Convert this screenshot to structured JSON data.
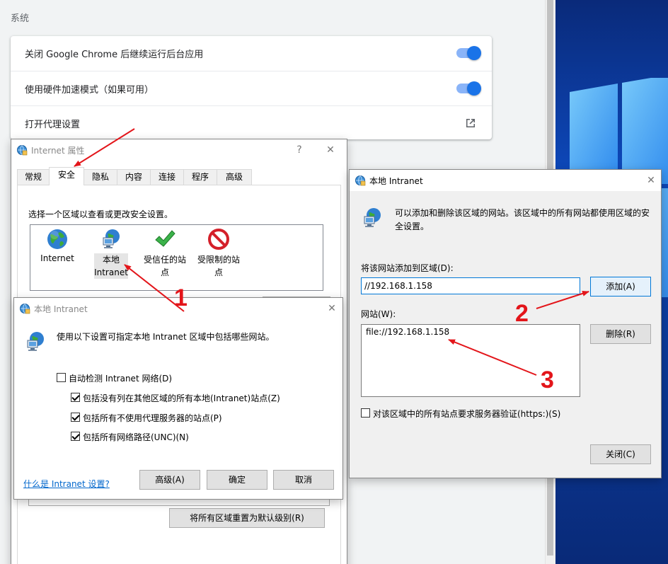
{
  "chrome_settings": {
    "section_title": "系统",
    "rows": [
      {
        "label": "关闭 Google Chrome 后继续运行后台应用",
        "type": "toggle",
        "checked": true
      },
      {
        "label": "使用硬件加速模式（如果可用）",
        "type": "toggle",
        "checked": true
      },
      {
        "label": "打开代理设置",
        "type": "external-link",
        "icon": "external-link-icon"
      }
    ]
  },
  "internet_properties": {
    "title": "Internet 属性",
    "help": "?",
    "close": "✕",
    "tabs": [
      "常规",
      "安全",
      "隐私",
      "内容",
      "连接",
      "程序",
      "高级"
    ],
    "active_tab": "安全",
    "prompt": "选择一个区域以查看或更改安全设置。",
    "zones": [
      {
        "label": "Internet",
        "icon": "globe-icon"
      },
      {
        "label": "本地 Intranet",
        "icon": "intranet-icon"
      },
      {
        "label": "受信任的站点",
        "icon": "checkmark-icon"
      },
      {
        "label": "受限制的站点",
        "icon": "forbidden-icon"
      }
    ],
    "reset_all_label": "将所有区域重置为默认级别(R)"
  },
  "intranet_small": {
    "title": "本地 Intranet",
    "close": "✕",
    "description": "使用以下设置可指定本地 Intranet 区域中包括哪些网站。",
    "options": [
      {
        "label": "自动检测 Intranet 网络(D)",
        "checked": false
      },
      {
        "label": "包括没有列在其他区域的所有本地(Intranet)站点(Z)",
        "checked": true
      },
      {
        "label": "包括所有不使用代理服务器的站点(P)",
        "checked": true
      },
      {
        "label": "包括所有网络路径(UNC)(N)",
        "checked": true
      }
    ],
    "help_link": "什么是 Intranet 设置?",
    "buttons": {
      "advanced": "高级(A)",
      "ok": "确定",
      "cancel": "取消"
    }
  },
  "intranet_large": {
    "title": "本地 Intranet",
    "close": "✕",
    "description": "可以添加和删除该区域的网站。该区域中的所有网站都使用区域的安全设置。",
    "add_label": "将该网站添加到区域(D):",
    "add_value": "//192.168.1.158",
    "add_button": "添加(A)",
    "sites_label": "网站(W):",
    "sites": [
      "file://192.168.1.158"
    ],
    "remove_button": "删除(R)",
    "https_option": {
      "label": "对该区域中的所有站点要求服务器验证(https:)(S)",
      "checked": false
    },
    "close_button": "关闭(C)"
  },
  "annotations": {
    "steps": [
      "1",
      "2",
      "3"
    ],
    "color": "#e3151a"
  }
}
